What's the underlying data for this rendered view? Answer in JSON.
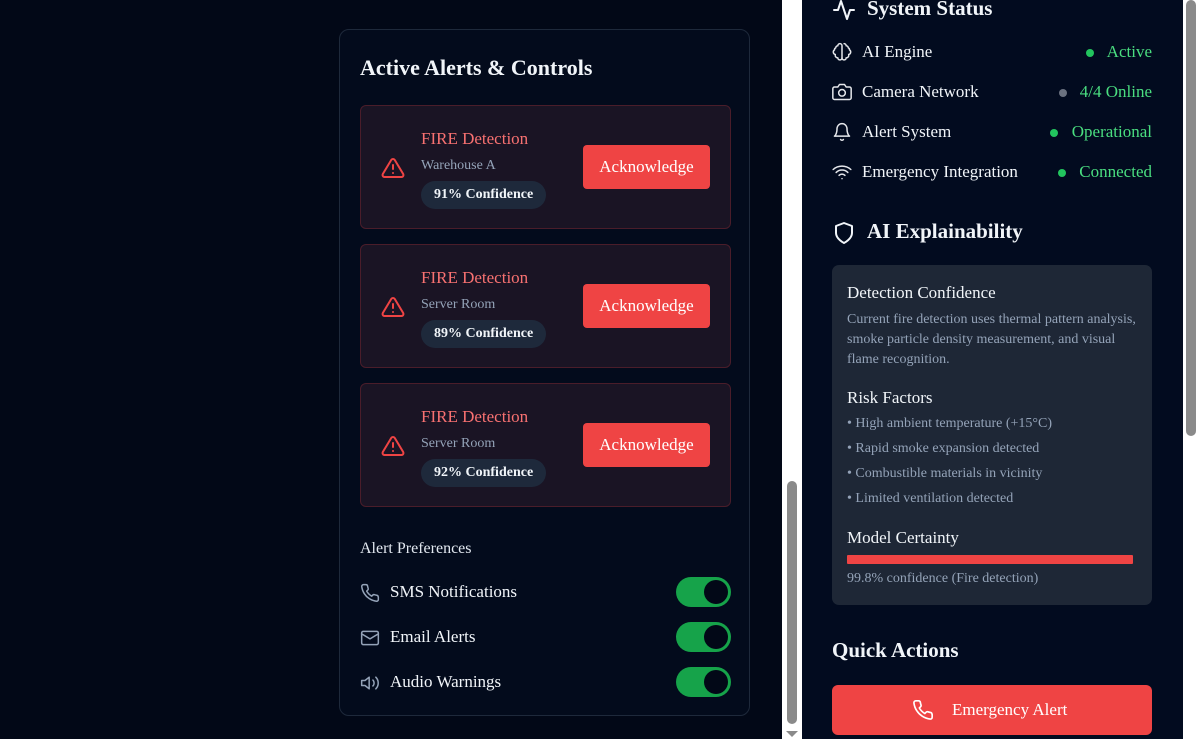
{
  "alerts_panel": {
    "title": "Active Alerts & Controls",
    "alerts": [
      {
        "title": "FIRE Detection",
        "location": "Warehouse A",
        "confidence": "91% Confidence",
        "action": "Acknowledge"
      },
      {
        "title": "FIRE Detection",
        "location": "Server Room",
        "confidence": "89% Confidence",
        "action": "Acknowledge"
      },
      {
        "title": "FIRE Detection",
        "location": "Server Room",
        "confidence": "92% Confidence",
        "action": "Acknowledge"
      }
    ],
    "preferences": {
      "title": "Alert Preferences",
      "items": [
        {
          "label": "SMS Notifications",
          "icon": "phone-icon",
          "enabled": true
        },
        {
          "label": "Email Alerts",
          "icon": "mail-icon",
          "enabled": true
        },
        {
          "label": "Audio Warnings",
          "icon": "speaker-icon",
          "enabled": true
        }
      ]
    }
  },
  "system_status": {
    "title": "System Status",
    "icon": "activity-icon",
    "items": [
      {
        "label": "AI Engine",
        "icon": "brain-icon",
        "value": "Active",
        "dot_color": "#22c55e",
        "value_color": "#4ade80"
      },
      {
        "label": "Camera Network",
        "icon": "camera-icon",
        "value": "4/4 Online",
        "dot_color": "#6b7280",
        "value_color": "#4ade80"
      },
      {
        "label": "Alert System",
        "icon": "bell-icon",
        "value": "Operational",
        "dot_color": "#22c55e",
        "value_color": "#4ade80"
      },
      {
        "label": "Emergency Integration",
        "icon": "wifi-icon",
        "value": "Connected",
        "dot_color": "#22c55e",
        "value_color": "#4ade80"
      }
    ]
  },
  "explainability": {
    "title": "AI Explainability",
    "icon": "shield-icon",
    "detection_title": "Detection Confidence",
    "detection_text": "Current fire detection uses thermal pattern analysis, smoke particle density measurement, and visual flame recognition.",
    "risk_title": "Risk Factors",
    "risk_factors": [
      "• High ambient temperature (+15°C)",
      "• Rapid smoke expansion detected",
      "• Combustible materials in vicinity",
      "• Limited ventilation detected"
    ],
    "certainty_title": "Model Certainty",
    "certainty_level": 0.998,
    "certainty_text": "99.8% confidence (Fire detection)"
  },
  "quick_actions": {
    "title": "Quick Actions",
    "emergency_label": "Emergency Alert"
  },
  "colors": {
    "accent_red": "#ef4444",
    "alert_text": "#f87171",
    "success": "#4ade80",
    "toggle_on": "#16a34a"
  }
}
